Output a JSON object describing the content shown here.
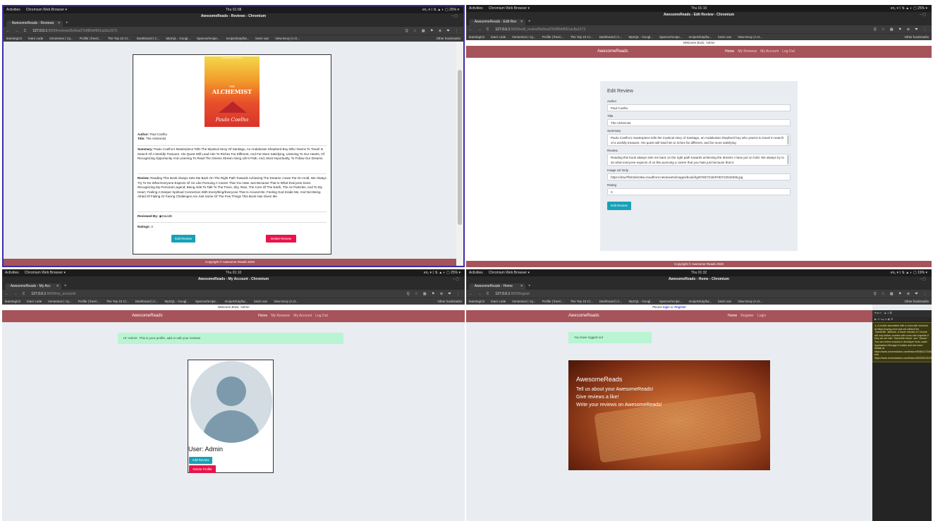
{
  "q1": {
    "os": {
      "activities": "Activities",
      "app": "Chromium Web Browser ▾",
      "clock": "Thu 01:08",
      "sys": "en₁ ▾  ⟟ ⇅ ▲ ◐ ▢ 25% ▾"
    },
    "window_title": "AwesomeReads - Reviews - Chromium",
    "tab": "AwesomeReads - Reviews",
    "url_host": "127.0.0.1",
    "url_path": ":5000/reviews/5e9ea37b080d4561ac8a1573",
    "nav_buttons": "← → C",
    "ext_icons": "Q ☆ ▦ ⚑ ⊕ ❤ ⋮",
    "bookmarks": [
      "learningCS",
      "learn code",
      "Immersive | Cy...",
      "Profile | freeC...",
      "The Top 10 Cr...",
      "Dashboard | C...",
      "MySQL - Googl...",
      "Spence/recipe...",
      "recipeGluty/ba...",
      "kevin xav",
      "View Envy (A.G..."
    ],
    "other_bookmarks": "Other bookmarks",
    "cover": {
      "tagline": "AN ENDURING CLASSIC",
      "the": "THE",
      "title": "ALCHEMIST",
      "author": "Paulo Coelho"
    },
    "author_label": "Author:",
    "author": "Paul Coelho",
    "title_label": "Title:",
    "title": "The Alchemist",
    "summary_label": "Summary:",
    "summary": "Paulo Coelho's Masterpiece Tells The Mystical Story Of Santiago, An Andalusian Shepherd Boy Who Yearns To Travel In Search Of A Worldly Treasure. His Quest Will Lead Him To Riches Far Different, And Far More Satisfying, Listening To Our Hearts, Of Recognizing Opportunity And Learning To Read The Omens Strewn Along Life's Path, And, Most Importantly, To Follow Our Dreams.",
    "review_label": "Review:",
    "review": "Reading This Book Always Sets Me Back On The Right Path Towards Achieving The Dreams I Have Put On Hold. We Always Try To Do What Everyone Expects Of Us Like Pursuing A Career That You Hate Just Because That Is What Everyone Does. Recognizing My Personal Legend; Being Able To Talk To The Trees, Sky, Rain, The Core Of The Earth, The Air Particles, And To My Heart, Feeling A Deeper Spiritual Connection With Everything/Everyone That Is Around Me, Feeling God Inside Me, And Not Being Afraid Of Failing Or Facing Challenges Are Just Some Of The Few Things This Book Has Given Me",
    "reviewed_by_label": "Reviewed By:",
    "reviewed_by": "DavidB",
    "ratings_label": "Ratings:",
    "ratings": "3",
    "edit_btn": "Edit Review",
    "delete_btn": "Delete Review",
    "footer": "Copyright © Awesome Reads 2020"
  },
  "q2": {
    "os": {
      "activities": "Activities",
      "app": "Chromium Web Browser ▾",
      "clock": "Thu 01:10",
      "sys": "en₁ ▾  ⟟ ⇅ ▲ ◐ ▢ 25% ▾"
    },
    "window_title": "AwesomeReads - Edit Review - Chromium",
    "tab": "AwesomeReads - Edit Rev",
    "url_host": "127.0.0.1",
    "url_path": ":5000/edit_review/5e9ea37b080d4561ac8a1573",
    "welcome": "Welcome Back, Admin",
    "brand": "AwesomeReads",
    "nav": [
      "Home",
      "My Reviews",
      "My Account",
      "Log Out"
    ],
    "form_title": "Edit Review",
    "fields": [
      {
        "label": "Author",
        "value": "Paul Coelho"
      },
      {
        "label": "Title",
        "value": "The Alchemist"
      },
      {
        "label": "Summary",
        "value": "Paulo Coelho's masterpiece tells the mystical story of Santiago, an Andalusian shepherd boy who yearns to travel in search of a worldly treasure. His quest will lead him to riches far different, and far more satisfying"
      },
      {
        "label": "Review",
        "value": "Reading this book always sets me back on the right path towards achieving the dreams I have put on hold. We always try to do what everyone expects of us like pursuing a career that you hate just because that is"
      },
      {
        "label": "Image Url Only",
        "value": "https://d1w7fb2mkkr3kw.cloudfront.net/assets/images/book/lrg/9780/7225/9780722532935.jpg"
      },
      {
        "label": "Rating",
        "value": "3"
      }
    ],
    "submit": "Edit Review",
    "footer": "Copyright © Awesome Reads 2020"
  },
  "q3": {
    "os": {
      "activities": "Activities",
      "app": "Chromium Web Browser ▾",
      "clock": "Thu 01:10",
      "sys": "en₁ ▾  ⟟ ⇅ ▲ ◐ ▢ 25% ▾"
    },
    "window_title": "AwesomeReads - My Account - Chromium",
    "tab": "AwesomeReads - My Acc",
    "url_host": "127.0.0.1",
    "url_path": ":5000/my_account/",
    "welcome": "Welcome Back, Admin",
    "brand": "AwesomeReads",
    "nav": [
      "Home",
      "My Reviews",
      "My Account",
      "Log Out"
    ],
    "alert": "Hi 'Admin'. This is your profile, add or edit your reviews",
    "user": "User: Admin",
    "add_btn": "Add Review",
    "delete_btn": "Delete Profile"
  },
  "q4": {
    "os": {
      "activities": "Activities",
      "app": "Chromium Web Browser ▾",
      "clock": "Thu 01:32",
      "sys": "en₁ ▾  ⟟ ⇅ ▲ ◐ ▢ 19% ▾"
    },
    "window_title": "AwesomeReads - Home - Chromium",
    "tab": "AwesomeReads - Home",
    "url_host": "127.0.0.1",
    "url_path": ":5000/logout",
    "welcome_pre": "Please ",
    "login": "login",
    "or": " or ",
    "register": "Register",
    "brand": "AwesomeReads",
    "nav": [
      "Home",
      "Register",
      "Login"
    ],
    "alert": "You have logged out",
    "hero_title": "AwesomeReads",
    "hero_lines": [
      "Tell us about your AwesomeReads!",
      "Give reviews a like!",
      "Write your reviews on AwesomeReads!"
    ],
    "devtools_warn_count": "▲ 1",
    "devtools_warn": "A cookie associated with a cross-site resource at https://unpkg.com/ was set without the `SameSite` attribute. A future release of Chrome will only deliver cookies with cross-site requests if they are set with `SameSite=None` and `Secure`. You can review cookies in developer tools under Application>Storage>Cookies and see more details at https://www.chromestatus.com/feature/5088147346030592 and https://www.chromestatus.com/feature/5633521622188032."
  }
}
